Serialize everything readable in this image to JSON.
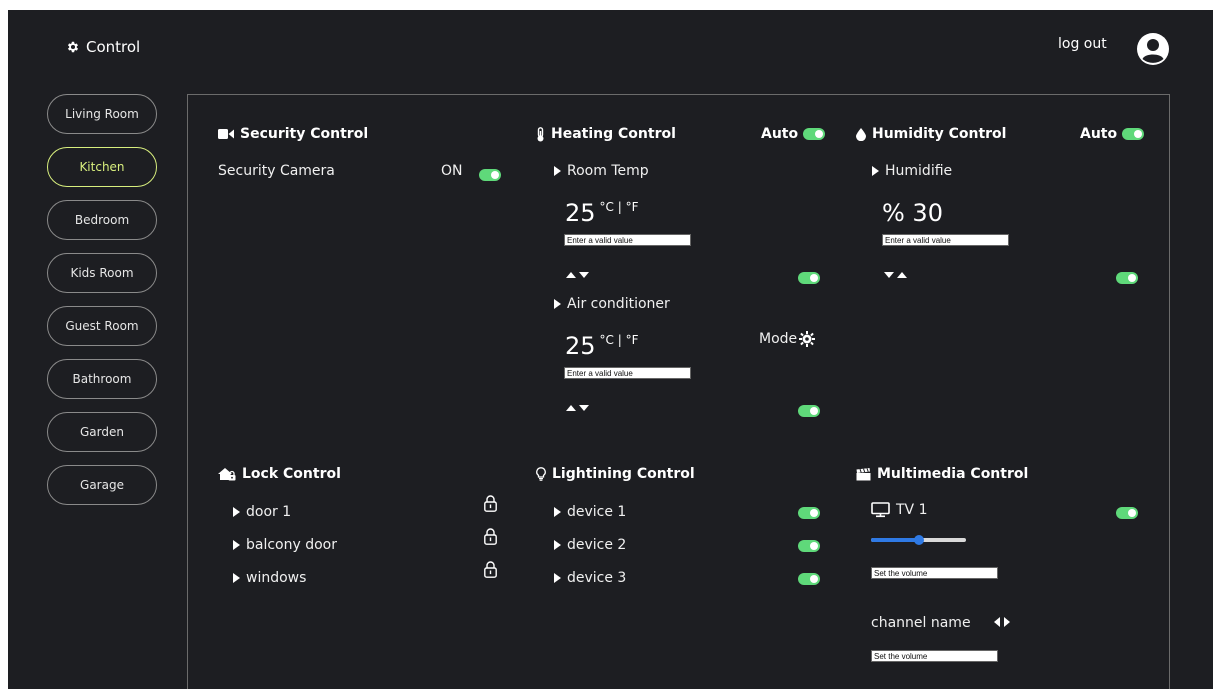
{
  "header": {
    "brand_label": "Control",
    "brand_icon": "gear-icon",
    "logout_label": "log out",
    "avatar_icon": "user-avatar-icon"
  },
  "sidebar": {
    "rooms": [
      {
        "label": "Living Room",
        "active": false
      },
      {
        "label": "Kitchen",
        "active": true
      },
      {
        "label": "Bedroom",
        "active": false
      },
      {
        "label": "Kids Room",
        "active": false
      },
      {
        "label": "Guest Room",
        "active": false
      },
      {
        "label": "Bathroom",
        "active": false
      },
      {
        "label": "Garden",
        "active": false
      },
      {
        "label": "Garage",
        "active": false
      }
    ],
    "active_color": "#d8ef7e"
  },
  "security": {
    "title": "Security Control",
    "icon": "video-camera-icon",
    "camera_label": "Security Camera",
    "camera_state": "ON"
  },
  "heating": {
    "title": "Heating Control",
    "icon": "thermometer-icon",
    "auto_label": "Auto",
    "room_temp": {
      "label": "Room Temp",
      "value": "25",
      "unit": "°C | °F",
      "placeholder": "Enter a valid value"
    },
    "air_conditioner": {
      "label": "Air conditioner",
      "value": "25",
      "unit": "°C | °F",
      "placeholder": "Enter a valid value",
      "mode_label": "Mode"
    }
  },
  "humidity": {
    "title": "Humidity Control",
    "icon": "water-drop-icon",
    "auto_label": "Auto",
    "humidifier": {
      "label": "Humidifie",
      "value": "% 30",
      "placeholder": "Enter a valid value"
    }
  },
  "lock": {
    "title": "Lock Control",
    "icon": "house-lock-icon",
    "items": [
      {
        "label": "door 1"
      },
      {
        "label": "balcony door"
      },
      {
        "label": "windows"
      }
    ]
  },
  "lighting": {
    "title": "Lightining Control",
    "icon": "lightbulb-icon",
    "items": [
      {
        "label": "device 1"
      },
      {
        "label": "device 2"
      },
      {
        "label": "device 3"
      }
    ]
  },
  "multimedia": {
    "title": "Multimedia Control",
    "icon": "clapperboard-icon",
    "tv_label": "TV 1",
    "volume_level": 0.5,
    "volume_placeholder": "Set the volume",
    "channel_label": "channel name",
    "channel_placeholder": "Set the volume"
  },
  "colors": {
    "background": "#1d1e22",
    "toggle_on": "#5fd97a",
    "slider": "#2f7ae5"
  }
}
